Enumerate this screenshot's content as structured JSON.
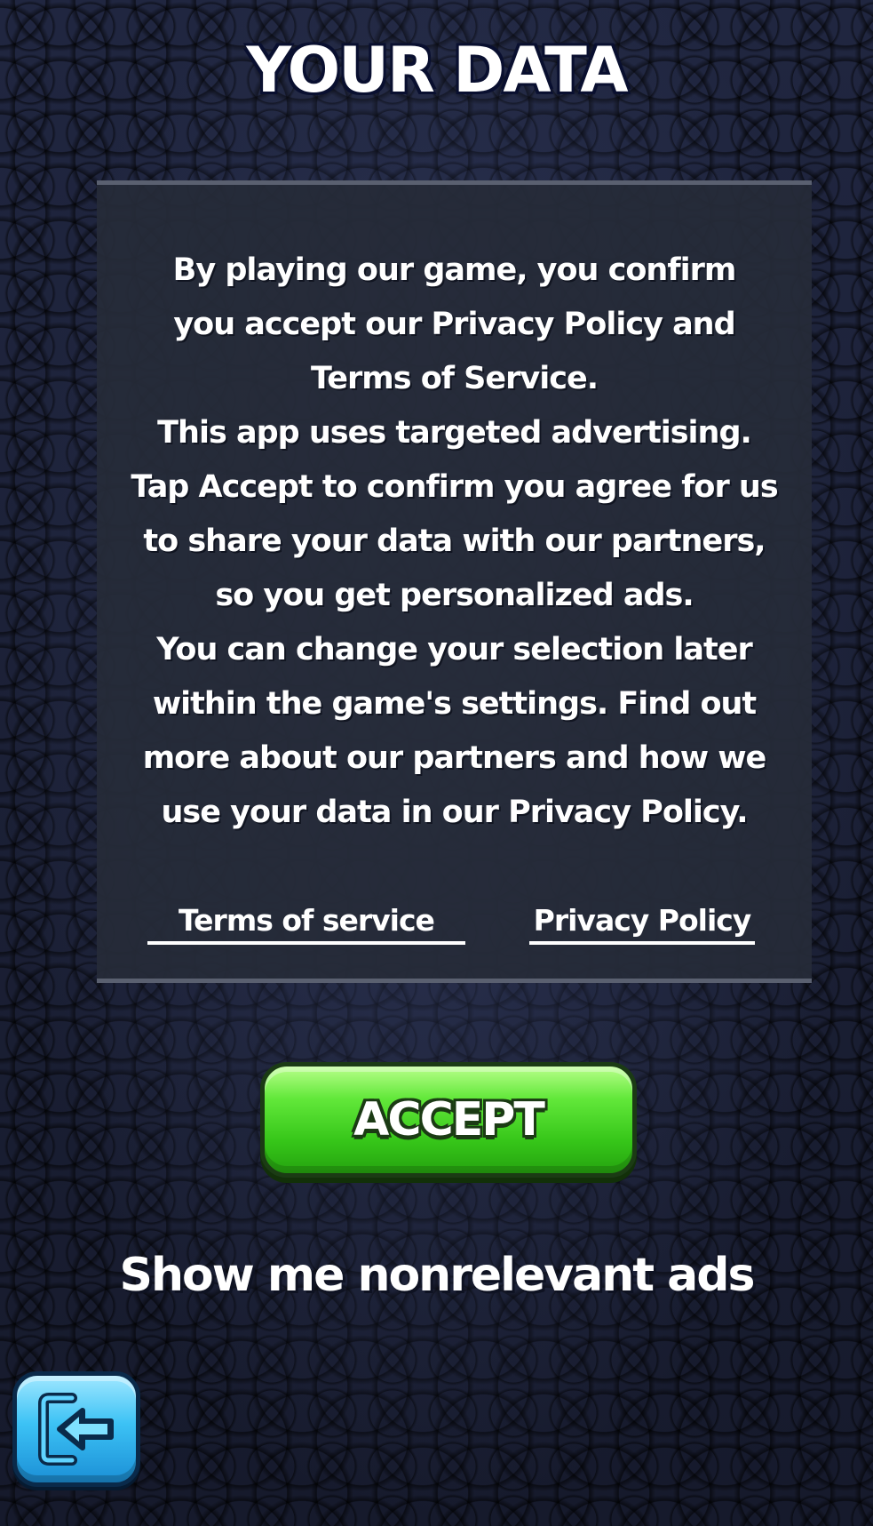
{
  "title": "YOUR DATA",
  "body": {
    "lines": [
      "By playing our game, you confirm",
      "you accept our Privacy Policy and",
      "Terms of Service.",
      "This app uses targeted advertising.",
      "Tap Accept to confirm you agree for us",
      "to share your data with our partners,",
      "so you get personalized ads.",
      "You can change your selection later",
      "within the game's settings. Find out",
      "more about our partners and how we",
      "use your data in our Privacy Policy."
    ]
  },
  "links": {
    "terms": "Terms of service",
    "privacy": "Privacy Policy"
  },
  "accept_label": "ACCEPT",
  "nonrelevant_label": "Show me nonrelevant ads",
  "back_icon": "exit-arrow-icon",
  "colors": {
    "accent_green": "#36c619",
    "back_blue": "#3cc2f5",
    "panel": "#262b38"
  }
}
